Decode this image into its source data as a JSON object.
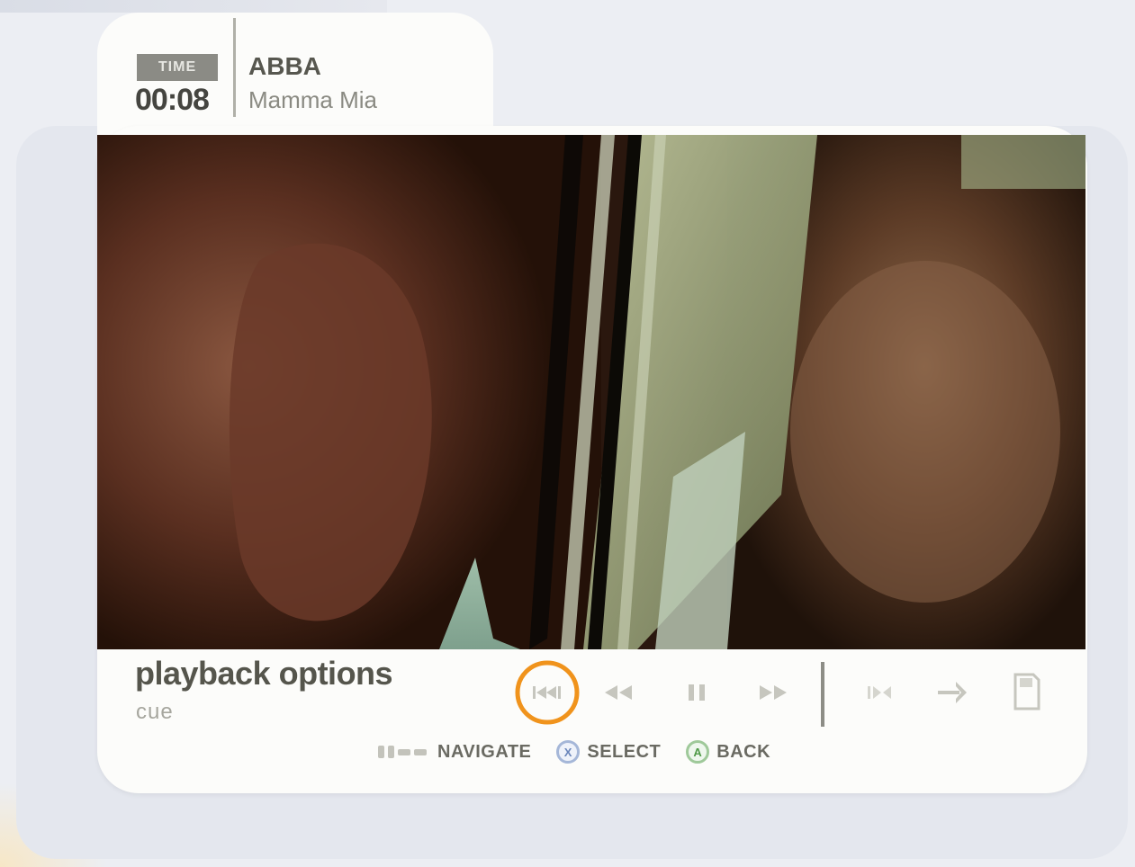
{
  "header": {
    "time_label": "TIME",
    "time_value": "00:08",
    "artist": "ABBA",
    "track": "Mamma Mia"
  },
  "panel": {
    "title": "playback options",
    "subtitle": "cue"
  },
  "controls": [
    {
      "name": "skip-back-button",
      "icon": "skip-previous-icon",
      "selected": true
    },
    {
      "name": "rewind-button",
      "icon": "rewind-icon",
      "selected": false
    },
    {
      "name": "pause-button",
      "icon": "pause-icon",
      "selected": false
    },
    {
      "name": "fast-forward-button",
      "icon": "fast-forward-icon",
      "selected": false
    },
    {
      "name": "chapter-button",
      "icon": "chapter-icon",
      "selected": false
    },
    {
      "name": "next-arrow-button",
      "icon": "arrow-right-icon",
      "selected": false
    },
    {
      "name": "save-button",
      "icon": "memory-card-icon",
      "selected": false
    }
  ],
  "hints": {
    "navigate": "NAVIGATE",
    "select_button": "X",
    "select": "SELECT",
    "back_button": "A",
    "back": "BACK"
  },
  "colors": {
    "selection_ring": "#f0931c",
    "control_icon": "#c6c6be",
    "card_background": "#fcfcfa",
    "time_badge": "#8b8b85"
  }
}
